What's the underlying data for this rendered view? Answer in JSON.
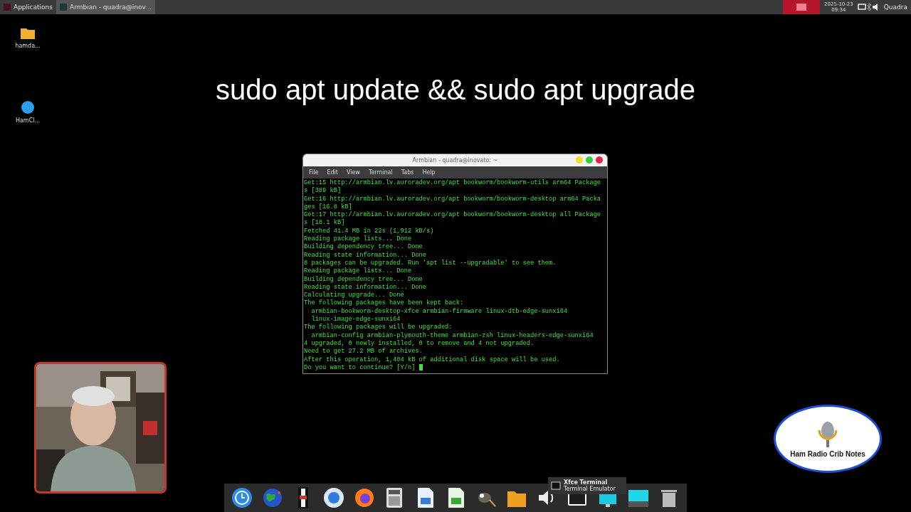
{
  "top_panel": {
    "applications_menu": "Applications",
    "task_button": "Armbian - quadra@inov...",
    "clock_date": "2025-10-23",
    "clock_time": "09:34",
    "user": "Quadra"
  },
  "desktop_icons": [
    {
      "kind": "folder",
      "label": "hamda..."
    },
    {
      "kind": "app",
      "label": "HamCl..."
    }
  ],
  "caption": "sudo apt update && sudo apt upgrade",
  "terminal": {
    "title": "Armbian - quadra@inovato: ~",
    "menu": [
      "File",
      "Edit",
      "View",
      "Terminal",
      "Tabs",
      "Help"
    ],
    "lines": [
      "Get:15 http://armbian.lv.auroradev.org/apt bookworm/bookworm-utils arm64 Package",
      "s [389 kB]",
      "Get:16 http://armbian.lv.auroradev.org/apt bookworm/bookworm-desktop arm64 Packa",
      "ges [16.8 kB]",
      "Get:17 http://armbian.lv.auroradev.org/apt bookworm/bookworm-desktop all Package",
      "s [18.1 kB]",
      "Fetched 41.4 MB in 22s (1,912 kB/s)",
      "Reading package lists... Done",
      "Building dependency tree... Done",
      "Reading state information... Done",
      "8 packages can be upgraded. Run 'apt list --upgradable' to see them.",
      "Reading package lists... Done",
      "Building dependency tree... Done",
      "Reading state information... Done",
      "Calculating upgrade... Done",
      "The following packages have been kept back:",
      "  armbian-bookworm-desktop-xfce armbian-firmware linux-dtb-edge-sunxi64",
      "  linux-image-edge-sunxi64",
      "The following packages will be upgraded:",
      "  armbian-config armbian-plymouth-theme armbian-zsh linux-headers-edge-sunxi64",
      "4 upgraded, 0 newly installed, 0 to remove and 4 not upgraded.",
      "Need to get 27.2 MB of archives.",
      "After this operation, 1,404 kB of additional disk space will be used.",
      "Do you want to continue? [Y/n] "
    ]
  },
  "dock_tooltip": {
    "title": "Xfce Terminal",
    "subtitle": "Terminal Emulator"
  },
  "logo": {
    "text": "Ham Radio Crib Notes"
  }
}
